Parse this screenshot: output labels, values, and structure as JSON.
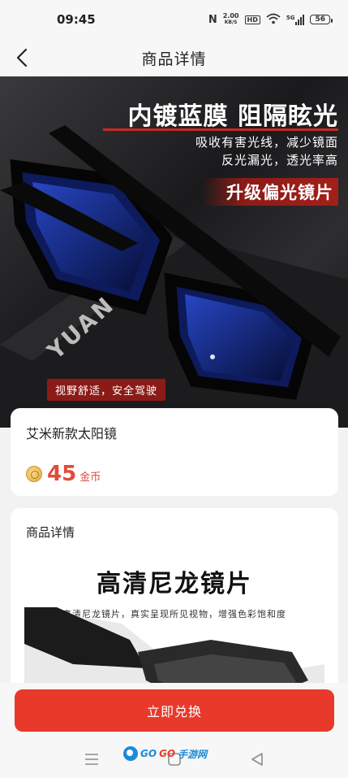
{
  "status_bar": {
    "time": "09:45",
    "net_speed_value": "2.00",
    "net_speed_unit": "KB/S",
    "hd_label": "HD",
    "signal_label": "5G",
    "battery": "56"
  },
  "header": {
    "title": "商品详情"
  },
  "hero": {
    "headline": "内镀蓝膜 阻隔眩光",
    "sub_line_1": "吸收有害光线，减少镜面",
    "sub_line_2": "反光漏光，透光率高",
    "tag": "升级偏光镜片",
    "pill": "视野舒适，安全驾驶",
    "brand": "YUAN"
  },
  "product": {
    "name": "艾米新款太阳镜",
    "price": "45",
    "unit": "金币"
  },
  "details": {
    "title": "商品详情",
    "headline": "高清尼龙镜片",
    "caption": "高清尼龙镜片，真实呈现所见视物，增强色彩饱和度"
  },
  "actions": {
    "redeem_label": "立即兑换"
  },
  "watermark": {
    "brand_a": "GO",
    "brand_b": "GO",
    "brand_c": "手游网"
  },
  "colors": {
    "accent": "#e8392b",
    "price": "#e24a3b",
    "hero_red": "#8b1b17"
  }
}
